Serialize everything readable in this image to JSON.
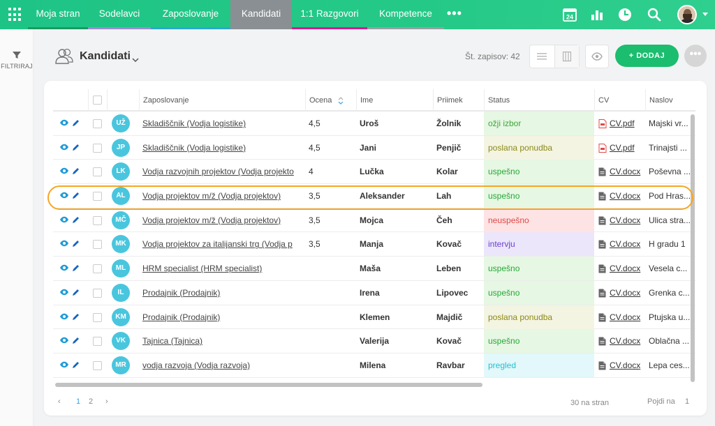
{
  "nav": {
    "tabs": [
      {
        "label": "Moja stran",
        "bar": "#1a9a5f"
      },
      {
        "label": "Sodelavci",
        "bar": "#9e8cd6"
      },
      {
        "label": "Zaposlovanje",
        "bar": "#2aa8d6"
      },
      {
        "label": "Kandidati",
        "bar": "#8a8f93"
      },
      {
        "label": "1:1 Razgovori",
        "bar": "#d81b8e"
      },
      {
        "label": "Kompetence",
        "bar": "#9aa0a4"
      }
    ],
    "more": "•••",
    "calendar_day": "24"
  },
  "sidebar": {
    "filter_label": "FILTRIRAJ"
  },
  "header": {
    "title": "Kandidati",
    "records": "Št. zapisov: 42",
    "add_label": "+ DODAJ",
    "more": "•••"
  },
  "table": {
    "columns": {
      "job": "Zaposlovanje",
      "rating": "Ocena",
      "first": "Ime",
      "last": "Priimek",
      "status": "Status",
      "cv": "CV",
      "address": "Naslov"
    },
    "rows": [
      {
        "initials": "UŽ",
        "job": "Skladiščnik (Vodja logistike)",
        "rating": "4,5",
        "first": "Uroš",
        "last": "Žolnik",
        "status": "ožji izbor",
        "cv": "CV.pdf",
        "cv_type": "pdf",
        "address": "Majski vr..."
      },
      {
        "initials": "JP",
        "job": "Skladiščnik (Vodja logistike)",
        "rating": "4,5",
        "first": "Jani",
        "last": "Penjič",
        "status": "poslana ponudba",
        "cv": "CV.pdf",
        "cv_type": "pdf",
        "address": "Trinajsti ..."
      },
      {
        "initials": "LK",
        "job": "Vodja razvojnih projektov (Vodja projekto",
        "rating": "4",
        "first": "Lučka",
        "last": "Kolar",
        "status": "uspešno",
        "cv": "CV.docx",
        "cv_type": "doc",
        "address": "Poševna ..."
      },
      {
        "initials": "AL",
        "job": "Vodja projektov m/ž (Vodja projektov)",
        "rating": "3,5",
        "first": "Aleksander",
        "last": "Lah",
        "status": "uspešno",
        "cv": "CV.docx",
        "cv_type": "doc",
        "address": "Pod Hras..."
      },
      {
        "initials": "MČ",
        "job": "Vodja projektov m/ž (Vodja projektov)",
        "rating": "3,5",
        "first": "Mojca",
        "last": "Čeh",
        "status": "neuspešno",
        "cv": "CV.docx",
        "cv_type": "doc",
        "address": "Ulica stra..."
      },
      {
        "initials": "MK",
        "job": "Vodja projektov za italijanski trg (Vodja p",
        "rating": "3,5",
        "first": "Manja",
        "last": "Kovač",
        "status": "intervju",
        "cv": "CV.docx",
        "cv_type": "doc",
        "address": "H gradu 1"
      },
      {
        "initials": "ML",
        "job": "HRM specialist (HRM specialist)",
        "rating": "",
        "first": "Maša",
        "last": "Leben",
        "status": "uspešno",
        "cv": "CV.docx",
        "cv_type": "doc",
        "address": "Vesela c..."
      },
      {
        "initials": "IL",
        "job": "Prodajnik (Prodajnik)",
        "rating": "",
        "first": "Irena",
        "last": "Lipovec",
        "status": "uspešno",
        "cv": "CV.docx",
        "cv_type": "doc",
        "address": "Grenka c..."
      },
      {
        "initials": "KM",
        "job": "Prodajnik (Prodajnik)",
        "rating": "",
        "first": "Klemen",
        "last": "Majdič",
        "status": "poslana ponudba",
        "cv": "CV.docx",
        "cv_type": "doc",
        "address": "Ptujska u..."
      },
      {
        "initials": "VK",
        "job": "Tajnica (Tajnica)",
        "rating": "",
        "first": "Valerija",
        "last": "Kovač",
        "status": "uspešno",
        "cv": "CV.docx",
        "cv_type": "doc",
        "address": "Oblačna ..."
      },
      {
        "initials": "MR",
        "job": "vodja razvoja (Vodja razvoja)",
        "rating": "",
        "first": "Milena",
        "last": "Ravbar",
        "status": "pregled",
        "cv": "CV.docx",
        "cv_type": "doc",
        "address": "Lepa ces..."
      }
    ],
    "status_colors": {
      "ožji izbor": {
        "bg": "#e6f7e3",
        "fg": "#3aa83a"
      },
      "poslana ponudba": {
        "bg": "#f4f4e2",
        "fg": "#8a8a1a"
      },
      "uspešno": {
        "bg": "#e6f7e3",
        "fg": "#27a838"
      },
      "neuspešno": {
        "bg": "#fde3e3",
        "fg": "#e04848"
      },
      "intervju": {
        "bg": "#ece6fb",
        "fg": "#6a3fd0"
      },
      "pregled": {
        "bg": "#e2f8fa",
        "fg": "#22c2d4"
      }
    }
  },
  "pagination": {
    "prev": "‹",
    "pages": [
      "1",
      "2"
    ],
    "next": "›",
    "per_page": "30 na stran",
    "goto_label": "Pojdi na",
    "goto_value": "1"
  }
}
